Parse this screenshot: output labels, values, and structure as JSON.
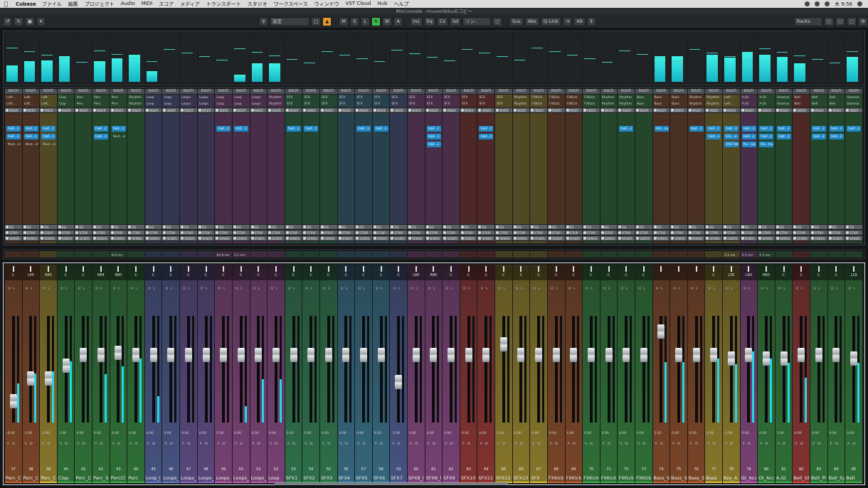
{
  "menubar": {
    "app": "Cubase",
    "items": [
      "ファイル",
      "編集",
      "プロジェクト",
      "Audio",
      "MIDI",
      "スコア",
      "メディア",
      "トランスポート",
      "スタジオ",
      "ワークスペース",
      "ウィンドウ",
      "VST Cloud",
      "Hub",
      "ヘルプ"
    ],
    "clock": "木 9:56"
  },
  "window": {
    "title": "MixConsole - munenikikuのコピー"
  },
  "toolbar": {
    "config": "設定",
    "buttons": [
      "M",
      "S",
      "L",
      "R",
      "W",
      "A",
      "Ins",
      "Eq",
      "Cs",
      "Sd"
    ],
    "link": "リン..",
    "sus": "Sus",
    "abs": "Abs",
    "qlink": "Q-Link",
    "count": "49",
    "racks": "Racks"
  },
  "channels": [
    {
      "num": "37",
      "name": "Perc_C",
      "color": "#c7652d",
      "pan": "C",
      "vol": "-6.00",
      "meter": 0.52,
      "level": 0.73,
      "route": "ROUTI",
      "io": "Left...",
      "plugs": [
        "FabF...2",
        "FabF...3",
        "Neut...er"
      ],
      "lat": ""
    },
    {
      "num": "38",
      "name": "Perc_C",
      "color": "#c7652d",
      "pan": "L65",
      "vol": "-3.00",
      "meter": 0.66,
      "level": 0.52,
      "route": "ROUTI",
      "io": "Left...",
      "plugs": [
        "FabF...2",
        "FabF...3",
        "Neut...er"
      ],
      "lat": ""
    },
    {
      "num": "39",
      "name": "Perc_C",
      "color": "#e0c033",
      "pan": "R65",
      "vol": "-3.00",
      "meter": 0.69,
      "level": 0.52,
      "route": "ROUTI",
      "io": "Left...",
      "plugs": [
        "FabF...2",
        "FabF...3",
        "Neut...er"
      ],
      "lat": ""
    },
    {
      "num": "40",
      "name": "Clap",
      "color": "#3fb34a",
      "pan": "C",
      "vol": "1.00",
      "meter": 0.82,
      "level": 0.4,
      "route": "ROUTI",
      "io": "Clap",
      "plugs": [],
      "lat": ""
    },
    {
      "num": "41",
      "name": "Perc_C",
      "color": "#3fb34a",
      "pan": "C",
      "vol": "0.00",
      "meter": 0.0,
      "level": 0.3,
      "route": "ROUTI",
      "io": "Perc",
      "plugs": [],
      "lat": ""
    },
    {
      "num": "42",
      "name": "Perc_S",
      "color": "#3fb34a",
      "pan": "R84",
      "vol": "0.00",
      "meter": 0.65,
      "level": 0.3,
      "route": "ROUTI",
      "io": "Perc",
      "plugs": [
        "FabF...2",
        "FabF...3"
      ],
      "lat": ""
    },
    {
      "num": "43",
      "name": "PercCl",
      "color": "#3fb34a",
      "pan": "R60",
      "vol": "0.00",
      "meter": 0.75,
      "level": 0.28,
      "route": "ROUTI",
      "io": "Perc",
      "plugs": [
        "FabF...3",
        "Neut...er"
      ],
      "lat": "6.0 ms"
    },
    {
      "num": "44",
      "name": "Perc",
      "color": "#3fb34a",
      "pan": "C",
      "vol": "0.00",
      "meter": 0.86,
      "level": 0.3,
      "route": "ROUTI",
      "io": "Rhythm",
      "plugs": [],
      "lat": ""
    },
    {
      "num": "45",
      "name": "Loop_I",
      "color": "#6a7fd1",
      "pan": "C",
      "vol": "0.00",
      "meter": 0.35,
      "level": 0.3,
      "route": "ROUTI",
      "io": "Loop",
      "plugs": [],
      "lat": ""
    },
    {
      "num": "46",
      "name": "Loops_",
      "color": "#6a7fd1",
      "pan": "C",
      "vol": "0.00",
      "meter": 0.0,
      "level": 0.3,
      "route": "ROUTI",
      "io": "Loop",
      "plugs": [],
      "lat": ""
    },
    {
      "num": "47",
      "name": "Loops_",
      "color": "#8b6ac9",
      "pan": "C",
      "vol": "0.00",
      "meter": 0.0,
      "level": 0.3,
      "route": "ROUTI",
      "io": "Loops",
      "plugs": [],
      "lat": ""
    },
    {
      "num": "48",
      "name": "Loops_",
      "color": "#8b6ac9",
      "pan": "C",
      "vol": "0.00",
      "meter": 0.0,
      "level": 0.3,
      "route": "ROUTI",
      "io": "Loops",
      "plugs": [],
      "lat": ""
    },
    {
      "num": "49",
      "name": "Loops",
      "color": "#c35fb8",
      "pan": "C",
      "vol": "0.00",
      "meter": 0.0,
      "level": 0.3,
      "route": "ROUTI",
      "io": "Loop",
      "plugs": [
        "FabF...2"
      ],
      "lat": "64.9 ms"
    },
    {
      "num": "50",
      "name": "Loops_",
      "color": "#c35fb8",
      "pan": "C",
      "vol": "0.00",
      "meter": 0.22,
      "level": 0.3,
      "route": "ROUTI",
      "io": "Loop",
      "plugs": [
        "UAD...2"
      ],
      "lat": "5.1 ms"
    },
    {
      "num": "51",
      "name": "Loops_",
      "color": "#c35fb8",
      "pan": "C",
      "vol": "0.00",
      "meter": 0.58,
      "level": 0.3,
      "route": "ROUTI",
      "io": "Loops",
      "plugs": [],
      "lat": ""
    },
    {
      "num": "52",
      "name": "Loop",
      "color": "#c35fb8",
      "pan": "C",
      "vol": "0.00",
      "meter": 0.58,
      "level": 0.3,
      "route": "ROUTI",
      "io": "Rhythm",
      "plugs": [],
      "lat": ""
    },
    {
      "num": "53",
      "name": "SFX1",
      "color": "#3db36b",
      "pan": "C",
      "vol": "0.00",
      "meter": 0.0,
      "level": 0.3,
      "route": "ROUTI",
      "io": "SFX",
      "plugs": [
        "FabF...3"
      ],
      "lat": ""
    },
    {
      "num": "54",
      "name": "SFX2",
      "color": "#3db36b",
      "pan": "C",
      "vol": "0.00",
      "meter": 0.0,
      "level": 0.3,
      "route": "ROUTI",
      "io": "SFX",
      "plugs": [
        "FabF...3"
      ],
      "lat": ""
    },
    {
      "num": "55",
      "name": "SFX3",
      "color": "#3db36b",
      "pan": "C",
      "vol": "0.00",
      "meter": 0.0,
      "level": 0.3,
      "route": "ROUTI",
      "io": "SFX",
      "plugs": [],
      "lat": ""
    },
    {
      "num": "56",
      "name": "SFX4",
      "color": "#4aa2c9",
      "pan": "C",
      "vol": "0.00",
      "meter": 0.0,
      "level": 0.3,
      "route": "ROUTI",
      "io": "SFX",
      "plugs": [],
      "lat": ""
    },
    {
      "num": "57",
      "name": "SFX5",
      "color": "#4aa2c9",
      "pan": "C",
      "vol": "0.00",
      "meter": 0.0,
      "level": 0.3,
      "route": "ROUTI",
      "io": "SFX",
      "plugs": [
        "FabF...3"
      ],
      "lat": ""
    },
    {
      "num": "58",
      "name": "SFX6",
      "color": "#4aa2c9",
      "pan": "C",
      "vol": "0.00",
      "meter": 0.0,
      "level": 0.3,
      "route": "ROUTI",
      "io": "SFX",
      "plugs": [
        "FabF...3"
      ],
      "lat": ""
    },
    {
      "num": "59",
      "name": "SFX7",
      "color": "#6a7fd1",
      "pan": "C",
      "vol": "-3.00",
      "meter": 0.0,
      "level": 0.55,
      "route": "ROUTI",
      "io": "SFX",
      "plugs": [],
      "lat": ""
    },
    {
      "num": "60",
      "name": "SFX8_l",
      "color": "#c35fb8",
      "pan": "L80",
      "vol": "0.00",
      "meter": 0.0,
      "level": 0.3,
      "route": "ROUTI",
      "io": "SFX",
      "plugs": [],
      "lat": ""
    },
    {
      "num": "61",
      "name": "SFX8_l",
      "color": "#c35fb8",
      "pan": "R80",
      "vol": "0.00",
      "meter": 0.0,
      "level": 0.3,
      "route": "ROUTI",
      "io": "SFX",
      "plugs": [
        "FabF...2",
        "FabF...3",
        "FabF...2"
      ],
      "lat": ""
    },
    {
      "num": "62",
      "name": "SFX9",
      "color": "#c35fb8",
      "pan": "C",
      "vol": "0.00",
      "meter": 0.0,
      "level": 0.3,
      "route": "ROUTI",
      "io": "SFX",
      "plugs": [],
      "lat": ""
    },
    {
      "num": "63",
      "name": "SFX10",
      "color": "#d8443f",
      "pan": "C",
      "vol": "0.00",
      "meter": 0.0,
      "level": 0.3,
      "route": "ROUTI",
      "io": "SFX",
      "plugs": [],
      "lat": ""
    },
    {
      "num": "64",
      "name": "SFX11",
      "color": "#d8443f",
      "pan": "C",
      "vol": "0.00",
      "meter": 0.0,
      "level": 0.3,
      "route": "ROUTI",
      "io": "SFX",
      "plugs": [
        "FabF...3",
        "FabF...3"
      ],
      "lat": ""
    },
    {
      "num": "65",
      "name": "SFX12",
      "color": "#e0c033",
      "pan": "C",
      "vol": "3.14",
      "meter": 0.0,
      "level": 0.2,
      "route": "ROUTI",
      "io": "SFX",
      "plugs": [],
      "lat": ""
    },
    {
      "num": "66",
      "name": "SFX13",
      "color": "#e0c033",
      "pan": "C",
      "vol": "0.00",
      "meter": 0.0,
      "level": 0.3,
      "route": "ROUTI",
      "io": "Rhythm",
      "plugs": [],
      "lat": ""
    },
    {
      "num": "67",
      "name": "SFX",
      "color": "#e0c033",
      "pan": "C",
      "vol": "0.00",
      "meter": 0.0,
      "level": 0.3,
      "route": "ROUTI",
      "io": "FXKick",
      "plugs": [],
      "lat": ""
    },
    {
      "num": "68",
      "name": "FXKick",
      "color": "#c7652d",
      "pan": "C",
      "vol": "0.00",
      "meter": 0.0,
      "level": 0.3,
      "route": "ROUTI",
      "io": "FXKick",
      "plugs": [],
      "lat": ""
    },
    {
      "num": "69",
      "name": "FXKick",
      "color": "#c7652d",
      "pan": "C",
      "vol": "0.00",
      "meter": 0.0,
      "level": 0.3,
      "route": "ROUTI",
      "io": "FXKick",
      "plugs": [],
      "lat": ""
    },
    {
      "num": "70",
      "name": "FXKick",
      "color": "#3fb34a",
      "pan": "C",
      "vol": "0.00",
      "meter": 0.0,
      "level": 0.3,
      "route": "ROUTI",
      "io": "FXKick",
      "plugs": [],
      "lat": ""
    },
    {
      "num": "71",
      "name": "FXKick",
      "color": "#3fb34a",
      "pan": "C",
      "vol": "0.00",
      "meter": 0.0,
      "level": 0.3,
      "route": "ROUTI",
      "io": "Rhythm",
      "plugs": [],
      "lat": ""
    },
    {
      "num": "72",
      "name": "FXKick",
      "color": "#3fb34a",
      "pan": "C",
      "vol": "0.00",
      "meter": 0.0,
      "level": 0.3,
      "route": "ROUTI",
      "io": "Rhythm",
      "plugs": [
        "FabF...3"
      ],
      "lat": ""
    },
    {
      "num": "73",
      "name": "FXKick",
      "color": "#3fb34a",
      "pan": "C",
      "vol": "0.00",
      "meter": 0.0,
      "level": 0.3,
      "route": "ROUTI",
      "io": "Bass",
      "plugs": [],
      "lat": ""
    },
    {
      "num": "74",
      "name": "Bass_S",
      "color": "#c7652d",
      "pan": "",
      "vol": "2.83",
      "meter": 0.81,
      "level": 0.08,
      "route": "ROUTI",
      "io": "Bass",
      "plugs": [
        "Hits...nu"
      ],
      "lat": ""
    },
    {
      "num": "75",
      "name": "Bass_S",
      "color": "#c7652d",
      "pan": "",
      "vol": "0.00",
      "meter": 0.81,
      "level": 0.3,
      "route": "ROUTI",
      "io": "Bass",
      "plugs": [],
      "lat": ""
    },
    {
      "num": "76",
      "name": "Bass_S",
      "color": "#c7652d",
      "pan": "",
      "vol": "0.00",
      "meter": 0.0,
      "level": 0.3,
      "route": "ROUTI",
      "io": "Rhythm",
      "plugs": [
        "FabF...2"
      ],
      "lat": ""
    },
    {
      "num": "77",
      "name": "Bass",
      "color": "#e0c033",
      "pan": "C",
      "vol": "0.00",
      "meter": 0.86,
      "level": 0.3,
      "route": "ROUTI",
      "io": "Rhythm",
      "plugs": [
        "FabF...2",
        "FabF...3"
      ],
      "lat": ""
    },
    {
      "num": "78",
      "name": "Key_A",
      "color": "#e0c033",
      "pan": "L35",
      "vol": "-1.00",
      "meter": 0.78,
      "level": 0.33,
      "route": "ROUTI",
      "io": "Left...",
      "plugs": [
        "FabF...3",
        "S11...ai",
        "UAD Tele"
      ],
      "lat": "5.2 ms"
    },
    {
      "num": "79",
      "name": "Gt_Acc",
      "color": "#c35fb8",
      "pan": "L60",
      "vol": "0.00",
      "meter": 0.95,
      "level": 0.3,
      "route": "ROUTI",
      "io": "A.Gt",
      "plugs": [
        "FabF...3",
        "FabF...2",
        "Pur...mo"
      ],
      "lat": "5.1 ms"
    },
    {
      "num": "80",
      "name": "Gt_Acc",
      "color": "#3fb34a",
      "pan": "R60",
      "vol": "0.00",
      "meter": 0.86,
      "level": 0.33,
      "route": "ROUTI",
      "io": "A.Gt",
      "plugs": [
        "FabF...3",
        "FabF...2",
        "Pur...mo"
      ],
      "lat": "5.1 ms"
    },
    {
      "num": "81",
      "name": "A.Gt",
      "color": "#3fb34a",
      "pan": "C",
      "vol": "1.00",
      "meter": 0.8,
      "level": 0.33,
      "route": "ROUTI",
      "io": "Ueamar",
      "plugs": [
        "FabF...3",
        "FabF...2"
      ],
      "lat": ""
    },
    {
      "num": "82",
      "name": "Bell_Gl",
      "color": "#d8443f",
      "pan": "C",
      "vol": "0.00",
      "meter": 0.6,
      "level": 0.3,
      "route": "ROUTI",
      "io": "Bell",
      "plugs": [],
      "lat": ""
    },
    {
      "num": "83",
      "name": "Bell_Pi",
      "color": "#3fb34a",
      "pan": "C",
      "vol": "0.00",
      "meter": 0.0,
      "level": 0.3,
      "route": "ROUTI",
      "io": "Bell",
      "plugs": [
        "FabF...3",
        "FabF...2"
      ],
      "lat": ""
    },
    {
      "num": "84",
      "name": "Bell_Sy",
      "color": "#3fb34a",
      "pan": "C",
      "vol": "0.00",
      "meter": 0.0,
      "level": 0.3,
      "route": "ROUTI",
      "io": "Bell",
      "plugs": [
        "FabF...3",
        "FabF...2"
      ],
      "lat": ""
    },
    {
      "num": "85",
      "name": "Bell",
      "color": "#3fb34a",
      "pan": "L19",
      "vol": "0.00",
      "meter": 0.8,
      "level": 0.33,
      "route": "ROUTI",
      "io": "Ueamar",
      "plugs": [
        "FabF...3"
      ],
      "lat": ""
    }
  ]
}
